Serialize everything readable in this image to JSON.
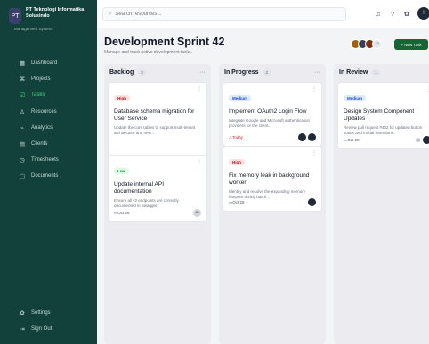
{
  "sidebar": {
    "brand_logo": "PT",
    "brand_name": "PT Teknologi Informatika Solusindo",
    "brand_sub": "Management System",
    "items": [
      {
        "icon": "▦",
        "label": "Dashboard"
      },
      {
        "icon": "⌘",
        "label": "Projects"
      },
      {
        "icon": "☑",
        "label": "Tasks"
      },
      {
        "icon": "♙",
        "label": "Resources"
      },
      {
        "icon": "⌁",
        "label": "Analytics"
      },
      {
        "icon": "▤",
        "label": "Clients"
      },
      {
        "icon": "◷",
        "label": "Timesheets"
      },
      {
        "icon": "▢",
        "label": "Documents"
      }
    ],
    "bottom": [
      {
        "icon": "✿",
        "label": "Settings"
      },
      {
        "icon": "⇥",
        "label": "Sign Out"
      }
    ]
  },
  "topbar": {
    "search_placeholder": "Search resources...",
    "avatar_initial": "!"
  },
  "header": {
    "title": "Development Sprint 42",
    "subtitle": "Manage and track active development tasks.",
    "team_more": "+3",
    "new_task_label": "+ New Task"
  },
  "columns": [
    {
      "title": "Backlog",
      "count": "3",
      "cards": [
        {
          "tag": "High",
          "title": "Database schema migration for User Service",
          "desc": "Update the core tables to support multi-tenant architecture and new...",
          "due": "Nov 24"
        },
        {
          "tag": "Low",
          "title": "Update internal API documentation",
          "desc": "Ensure all v2 endpoints are correctly documented in Swagger.",
          "due": "Oct 28",
          "assignee": "JD"
        }
      ]
    },
    {
      "title": "In Progress",
      "count": "2",
      "cards": [
        {
          "tag": "Medium",
          "title": "Implement OAuth2 Login Flow",
          "desc": "Integrate Google and Microsoft authentication providers for the client...",
          "due": "Today"
        },
        {
          "tag": "High",
          "title": "Fix memory leak in background worker",
          "desc": "Identify and resolve the expanding memory footprint during batch...",
          "due": "Oct 25"
        }
      ]
    },
    {
      "title": "In Review",
      "count": "1",
      "cards": [
        {
          "tag": "Medium",
          "title": "Design System Component Updates",
          "desc": "Review pull request #402 for updated button states and modal transitions.",
          "due": "Oct 29"
        }
      ]
    }
  ],
  "colors": {
    "sidebar_bg": "#12403a",
    "accent": "#166534",
    "active_nav": "#4ade80"
  }
}
